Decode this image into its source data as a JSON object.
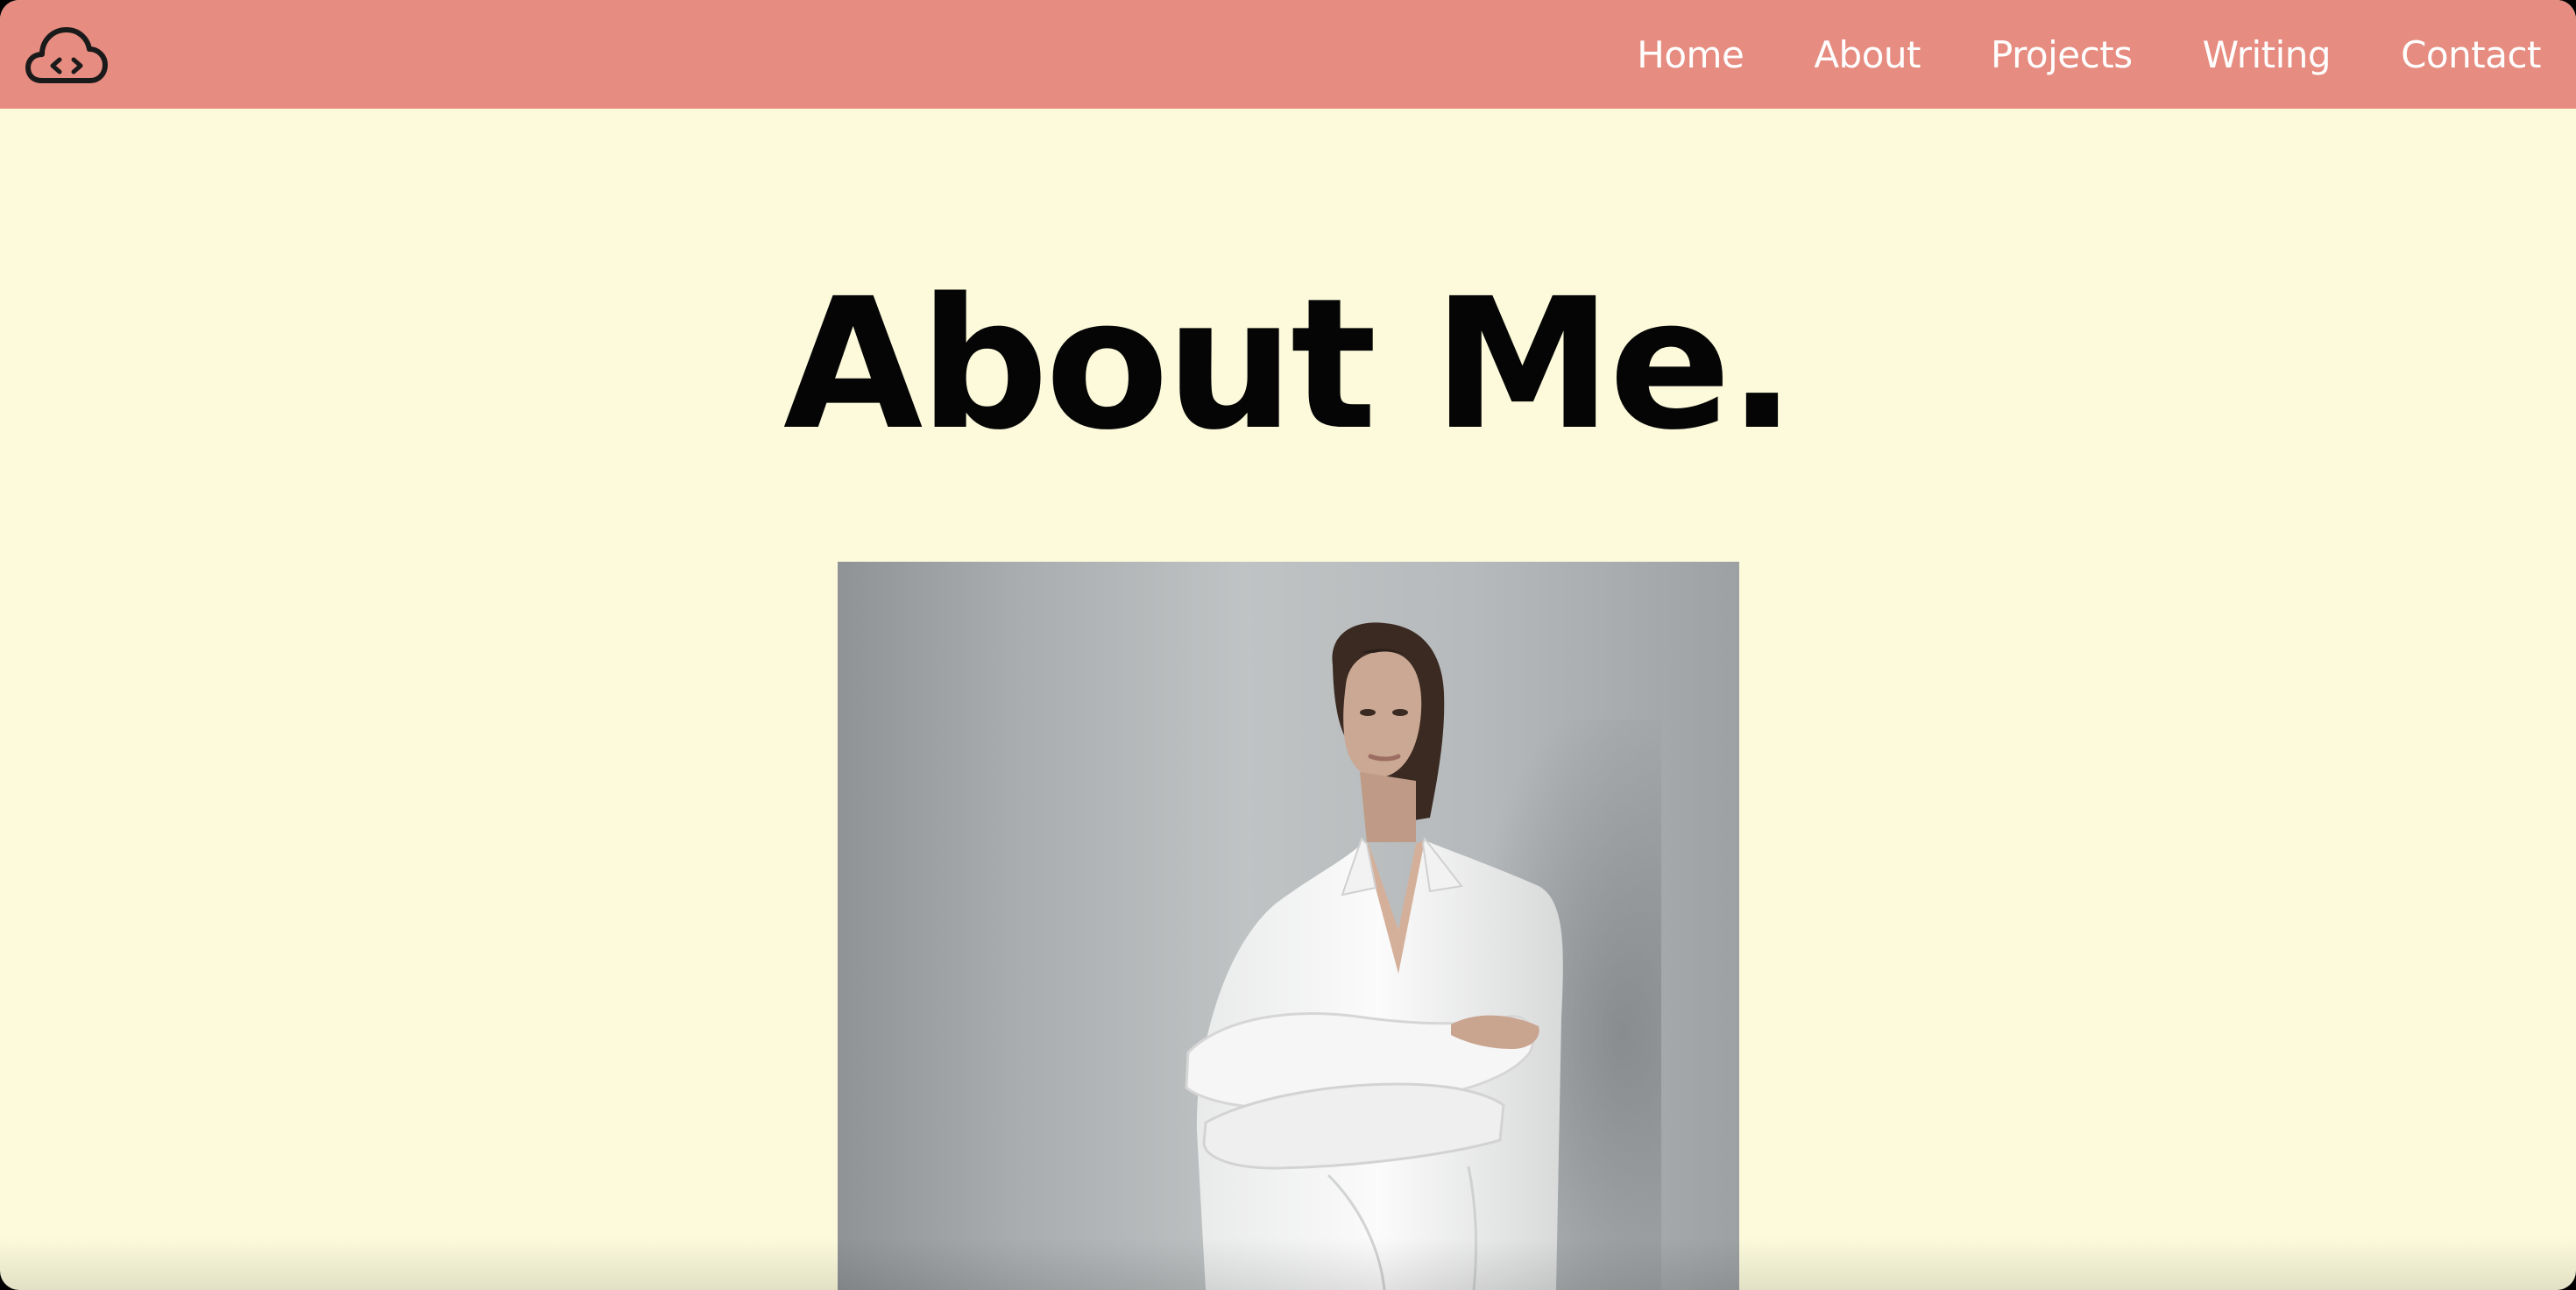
{
  "nav": {
    "logo_icon": "cloud-code-icon",
    "links": [
      {
        "label": "Home"
      },
      {
        "label": "About"
      },
      {
        "label": "Projects"
      },
      {
        "label": "Writing"
      },
      {
        "label": "Contact"
      }
    ]
  },
  "main": {
    "title": "About Me.",
    "portrait": {
      "subject": "woman in white shirt with crossed arms leaning against a wall"
    }
  },
  "colors": {
    "nav_background": "#E68C80",
    "page_background": "#FCFADB",
    "nav_text": "#FFFFFF",
    "title_text": "#050505"
  }
}
